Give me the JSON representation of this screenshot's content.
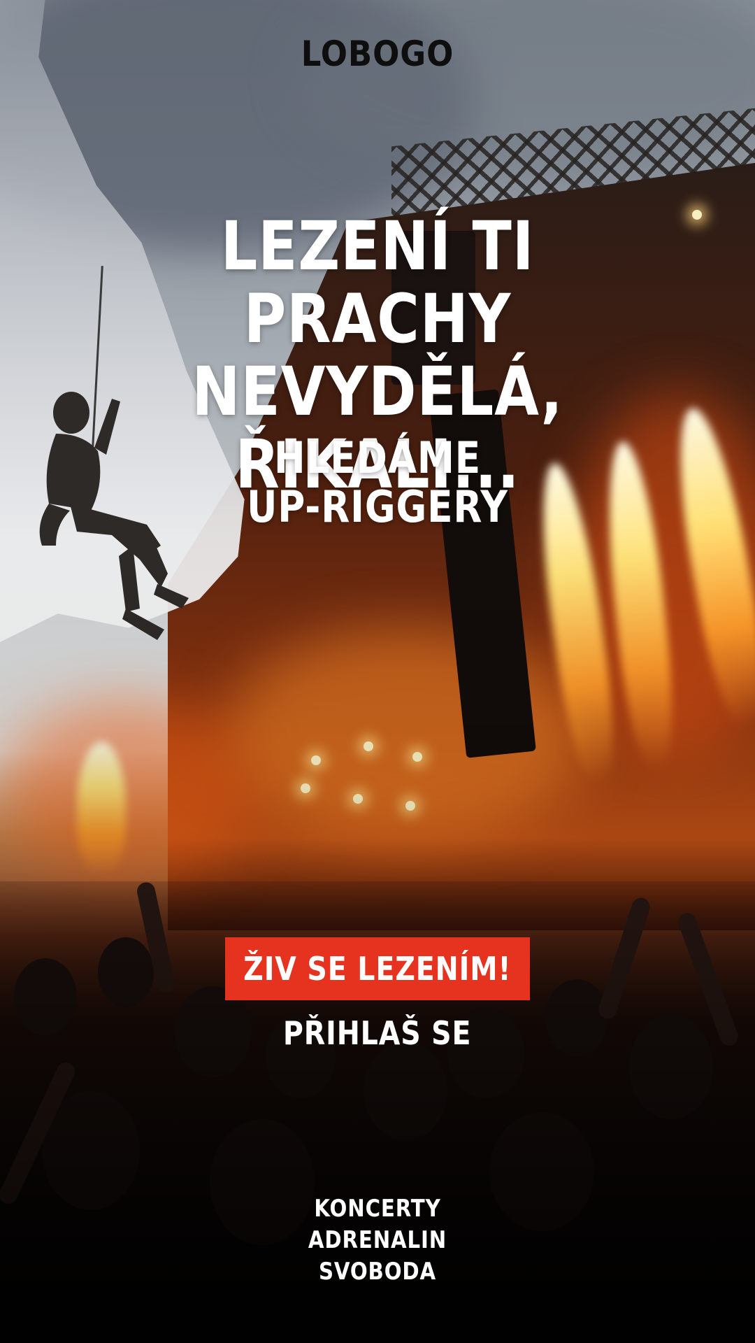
{
  "brand": {
    "logo": "LOBOGO"
  },
  "hero": {
    "headline_line1": "LEZENÍ TI PRACHY",
    "headline_line2": "NEVYDĚLÁ, ŘIKALI...",
    "sub_line1": "HLEDÁME",
    "sub_line2": "UP-RIGGERY"
  },
  "actions": {
    "cta_label": "ŽIV SE LEZENÍM!",
    "signup_label": "PŘIHLAŠ SE"
  },
  "tags": [
    "KONCERTY",
    "ADRENALIN",
    "SVOBODA"
  ],
  "colors": {
    "accent": "#e5331f",
    "text": "#ffffff",
    "logo": "#0e0e0e"
  }
}
